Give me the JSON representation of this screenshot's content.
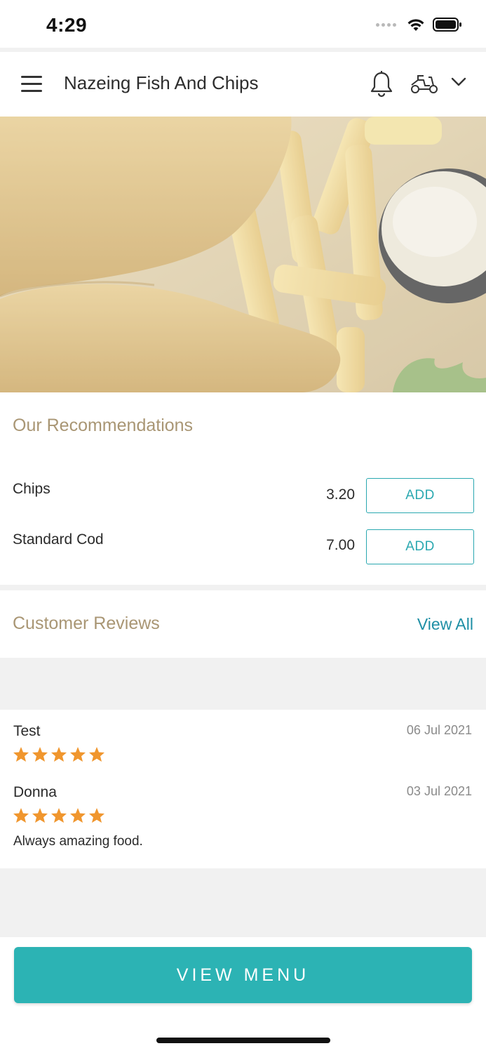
{
  "status_bar": {
    "time": "4:29"
  },
  "header": {
    "title": "Nazeing Fish And Chips"
  },
  "icons": {
    "menu": "hamburger-menu-icon",
    "notifications": "bell-icon",
    "delivery": "scooter-icon",
    "dropdown": "chevron-down-icon",
    "rating": "star-icon"
  },
  "recommendations": {
    "title": "Our Recommendations",
    "items": [
      {
        "name": "Chips",
        "price": "3.20",
        "button": "ADD"
      },
      {
        "name": "Standard Cod",
        "price": "7.00",
        "button": "ADD"
      }
    ]
  },
  "reviews": {
    "title": "Customer Reviews",
    "view_all": "View All",
    "items": [
      {
        "name": "Test",
        "date": "06 Jul 2021",
        "rating": 5,
        "text": ""
      },
      {
        "name": "Donna",
        "date": "03 Jul 2021",
        "rating": 5,
        "text": "Always amazing food."
      }
    ]
  },
  "footer": {
    "view_menu": "VIEW MENU"
  },
  "colors": {
    "accent": "#2cb3b4",
    "section_title": "#a99674",
    "link": "#1f8fa5",
    "star": "#f0962e"
  }
}
